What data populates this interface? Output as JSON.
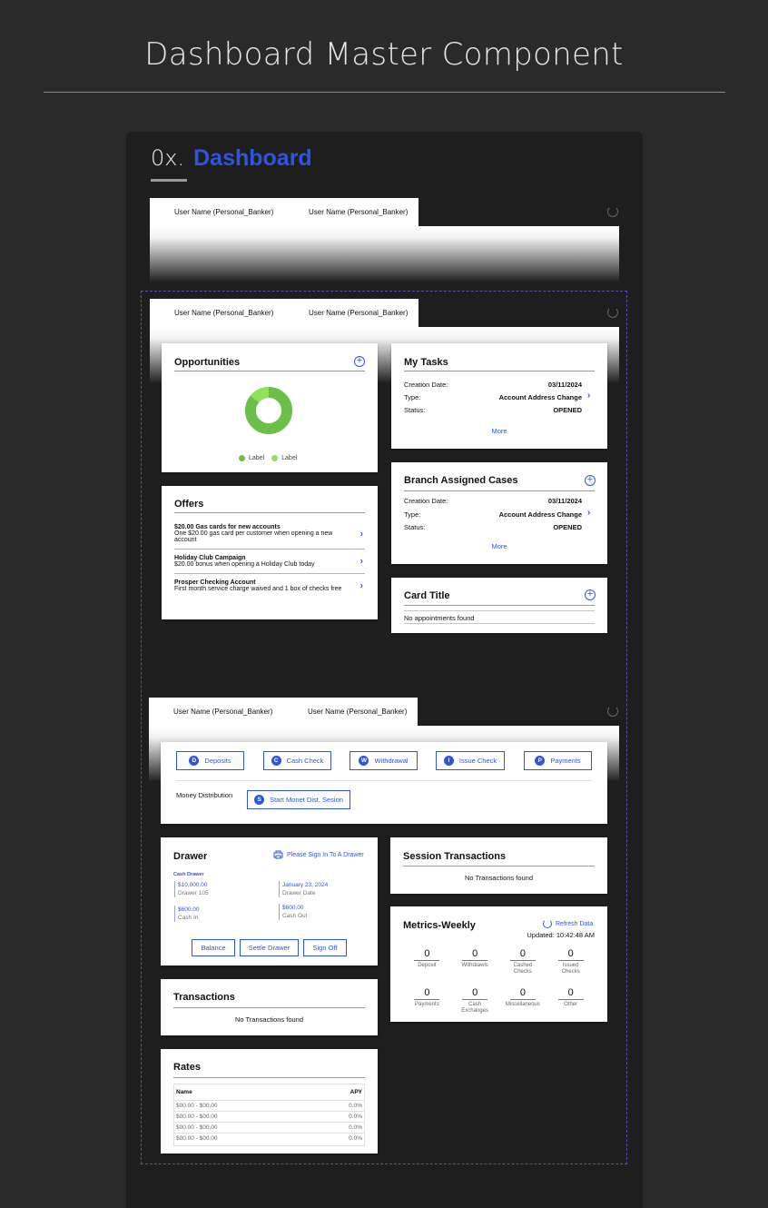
{
  "page": {
    "title": "Dashboard Master Component"
  },
  "section": {
    "number": "0x.",
    "title": "Dashboard"
  },
  "tabs": [
    "User Name (Personal_Banker)",
    "User Name (Personal_Banker)"
  ],
  "opportunities": {
    "title": "Opportunities",
    "legend": [
      "Label",
      "Label"
    ],
    "colors": [
      "#6cc04a",
      "#8fe25a"
    ]
  },
  "offers": {
    "title": "Offers",
    "items": [
      {
        "title": "$20.00 Gas cards for new accounts",
        "desc": "One $20.00 gas card per customer when opening a new account"
      },
      {
        "title": "Holiday Club Campaign",
        "desc": "$20.00 bonus when opening a Holiday Club today"
      },
      {
        "title": "Prosper Checking Account",
        "desc": "First month service charge waived and 1 box of checks free"
      }
    ]
  },
  "my_tasks": {
    "title": "My Tasks",
    "rows": [
      {
        "label": "Creation Date:",
        "value": "03/11/2024"
      },
      {
        "label": "Type:",
        "value": "Account Address Change"
      },
      {
        "label": "Status:",
        "value": "OPENED"
      }
    ],
    "more": "More"
  },
  "branch_cases": {
    "title": "Branch Assigned Cases",
    "rows": [
      {
        "label": "Creation Date:",
        "value": "03/11/2024"
      },
      {
        "label": "Type:",
        "value": "Account Address Change"
      },
      {
        "label": "Status:",
        "value": "OPENED"
      }
    ],
    "more": "More"
  },
  "card_title": {
    "title": "Card Title",
    "empty": "No appointments found"
  },
  "actions": [
    {
      "badge": "D",
      "label": "Deposits"
    },
    {
      "badge": "C",
      "label": "Cash Check"
    },
    {
      "badge": "W",
      "label": "Withdrawal"
    },
    {
      "badge": "I",
      "label": "Issue Check"
    },
    {
      "badge": "P",
      "label": "Payments"
    }
  ],
  "money_distribution": {
    "label": "Money Distribution",
    "badge": "S",
    "button": "Start Monet Dist. Sesion"
  },
  "drawer": {
    "title": "Drawer",
    "sign_in": "Please Sign In To A Drawer",
    "section": "Cash Drawer",
    "items": [
      {
        "value": "$10,000.00",
        "label": "Drawer 105"
      },
      {
        "value": "January 23, 2024",
        "label": "Drawer Date"
      },
      {
        "value": "$600.00",
        "label": "Cash In"
      },
      {
        "value": "$600.00",
        "label": "Cash Out"
      }
    ],
    "buttons": [
      "Balance",
      "Settle Drawer",
      "Sign Off"
    ]
  },
  "session_transactions": {
    "title": "Session Transactions",
    "empty": "No Transactions found"
  },
  "transactions": {
    "title": "Transactions",
    "empty": "No Transactions found"
  },
  "metrics": {
    "title": "Metrics-Weekly",
    "refresh": "Refresh Data",
    "updated": "Updated: 10:42:48 AM",
    "items": [
      {
        "value": "0",
        "label": "Deposit"
      },
      {
        "value": "0",
        "label": "Withdrawls"
      },
      {
        "value": "0",
        "label": "Cashed Checks"
      },
      {
        "value": "0",
        "label": "Issued Checks"
      },
      {
        "value": "0",
        "label": "Payments"
      },
      {
        "value": "0",
        "label": "Cash Exchanges"
      },
      {
        "value": "0",
        "label": "Miscellaneous"
      },
      {
        "value": "0",
        "label": "Other"
      }
    ]
  },
  "rates": {
    "title": "Rates",
    "headers": [
      "Name",
      "APY"
    ],
    "rows": [
      [
        "$00.00 - $00.00",
        "0.0%"
      ],
      [
        "$00.00 - $00.00",
        "0.0%"
      ],
      [
        "$00.00 - $00.00",
        "0.0%"
      ],
      [
        "$00.00 - $00.00",
        "0.0%"
      ]
    ]
  }
}
